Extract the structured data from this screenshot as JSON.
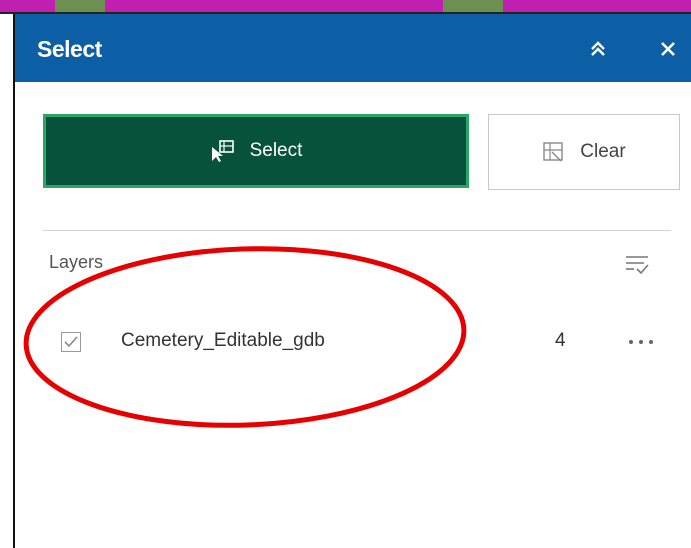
{
  "panel": {
    "title": "Select"
  },
  "actions": {
    "select_label": "Select",
    "clear_label": "Clear"
  },
  "layers": {
    "label": "Layers",
    "items": [
      {
        "name": "Cemetery_Editable_gdb",
        "count": "4",
        "checked": true
      }
    ]
  },
  "colors": {
    "header": "#0d5fa5",
    "select_button": "#06523a",
    "select_border": "#2aa66b",
    "annotation": "#e60000"
  },
  "icons": {
    "collapse": "double-chevron-up-icon",
    "close": "close-icon",
    "select": "select-cursor-icon",
    "clear": "clear-selection-icon",
    "filter": "filter-list-icon",
    "more": "more-options-icon"
  }
}
